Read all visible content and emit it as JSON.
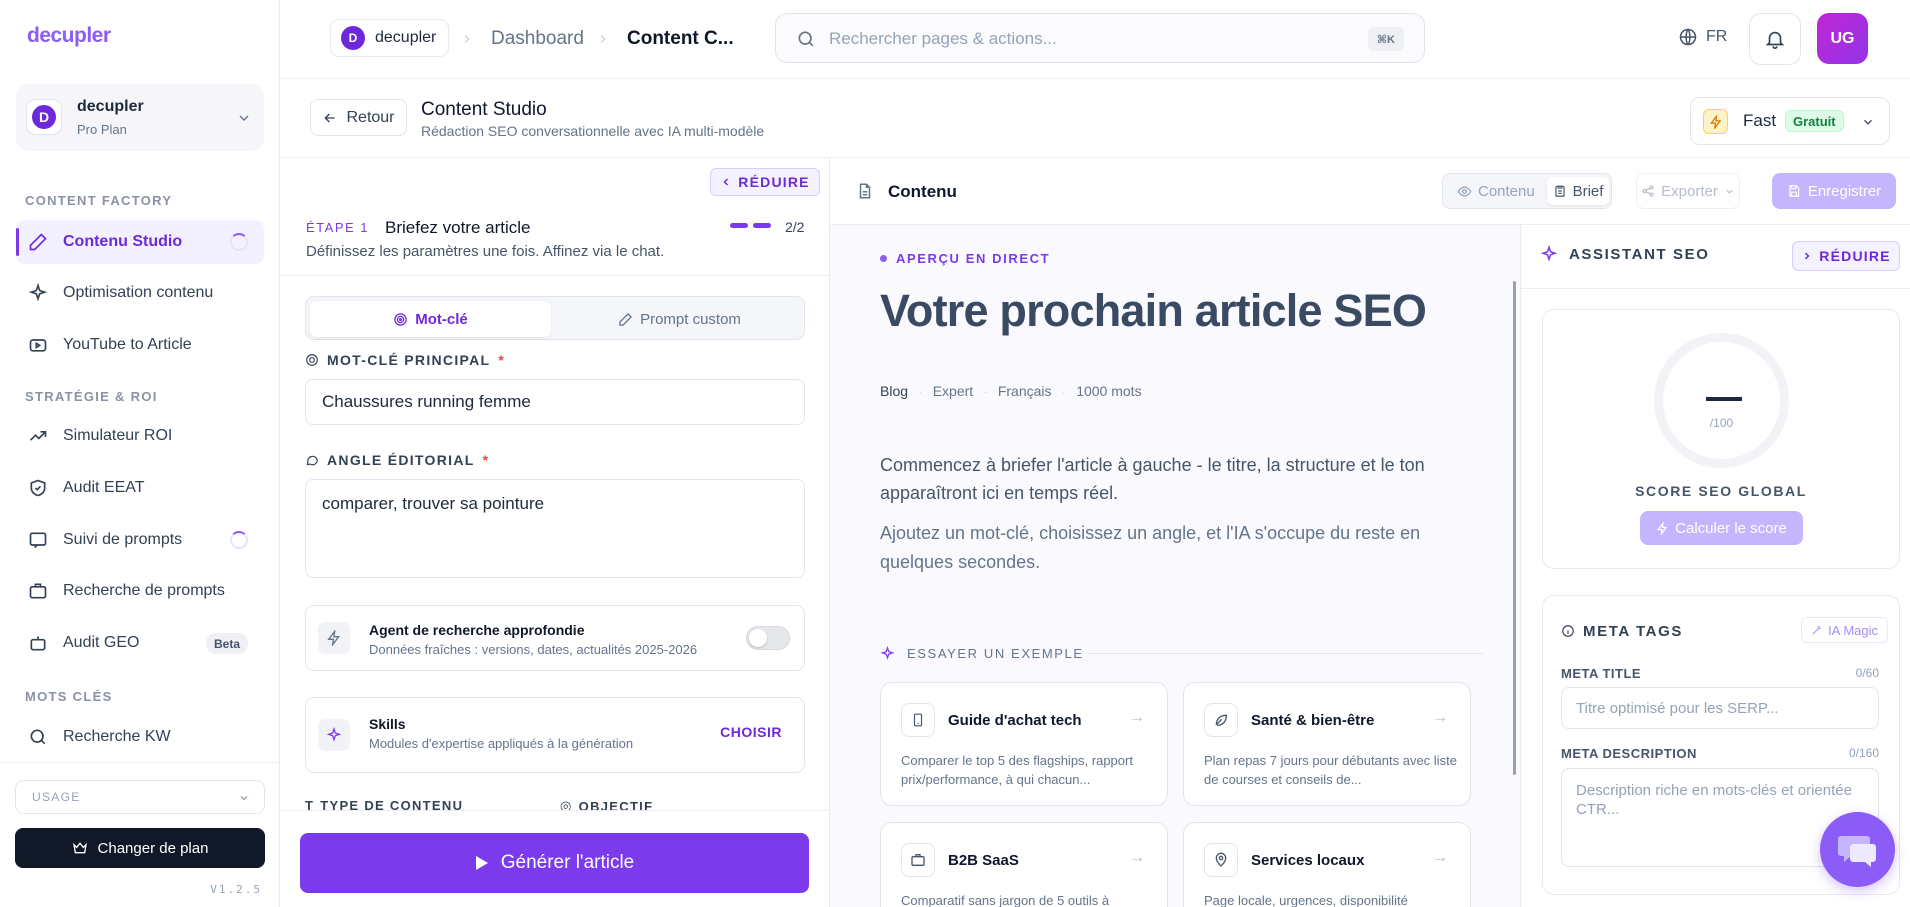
{
  "sidebar": {
    "logo": "decupler",
    "workspace": {
      "initial": "D",
      "name": "decupler",
      "plan": "Pro Plan"
    },
    "sections": [
      {
        "title": "CONTENT FACTORY",
        "items": [
          {
            "label": "Contenu Studio",
            "icon": "pencil-icon",
            "active": true,
            "loading": true
          },
          {
            "label": "Optimisation contenu",
            "icon": "sparkles-icon"
          },
          {
            "label": "YouTube to Article",
            "icon": "youtube-icon"
          }
        ]
      },
      {
        "title": "STRATÉGIE & ROI",
        "items": [
          {
            "label": "Simulateur ROI",
            "icon": "trending-up-icon"
          },
          {
            "label": "Audit EEAT",
            "icon": "shield-icon"
          },
          {
            "label": "Suivi de prompts",
            "icon": "message-icon",
            "loading": true
          },
          {
            "label": "Recherche de prompts",
            "icon": "briefcase-icon"
          },
          {
            "label": "Audit GEO",
            "icon": "bot-icon",
            "badge": "Beta"
          }
        ]
      },
      {
        "title": "MOTS CLÉS",
        "items": [
          {
            "label": "Recherche KW",
            "icon": "search-icon"
          }
        ]
      }
    ],
    "usage_label": "USAGE",
    "change_plan": "Changer de plan",
    "version": "V1.2.5"
  },
  "topbar": {
    "breadcrumb": {
      "workspace": "decupler",
      "workspace_initial": "D",
      "dashboard": "Dashboard",
      "current": "Content C..."
    },
    "search": {
      "placeholder": "Rechercher pages & actions...",
      "shortcut": "⌘K"
    },
    "language": "FR",
    "user_initials": "UG"
  },
  "page_header": {
    "back": "Retour",
    "title": "Content Studio",
    "subtitle": "Rédaction SEO conversationnelle avec IA multi-modèle",
    "model": {
      "name": "Fast",
      "badge": "Gratuit"
    }
  },
  "brief": {
    "collapse": "RÉDUIRE",
    "step_label": "ÉTAPE 1",
    "step_title": "Briefez votre article",
    "step_desc": "Définissez les paramètres une fois. Affinez via le chat.",
    "progress": "2/2",
    "modes": {
      "keyword": "Mot-clé",
      "prompt": "Prompt custom"
    },
    "keyword_label": "MOT-CLÉ PRINCIPAL",
    "keyword_value": "Chaussures running femme",
    "angle_label": "ANGLE ÉDITORIAL",
    "angle_value": "comparer, trouver sa pointure",
    "research": {
      "title": "Agent de recherche approfondie",
      "desc": "Données fraîches : versions, dates, actualités 2025-2026"
    },
    "skills": {
      "title": "Skills",
      "desc": "Modules d'expertise appliqués à la génération",
      "action": "CHOISIR"
    },
    "content_type_label": "TYPE DE CONTENU",
    "goal_label": "OBJECTIF",
    "generate": "Générer l'article"
  },
  "preview": {
    "title": "Contenu",
    "tabs": {
      "content": "Contenu",
      "brief": "Brief"
    },
    "export": "Exporter",
    "save": "Enregistrer",
    "live": "APERÇU EN DIRECT",
    "headline": "Votre prochain article SEO",
    "meta": [
      "Blog",
      "Expert",
      "Français",
      "1000 mots"
    ],
    "para1": "Commencez à briefer l'article à gauche - le titre, la structure et le ton apparaîtront ici en temps réel.",
    "para2": "Ajoutez un mot-clé, choisissez un angle, et l'IA s'occupe du reste en quelques secondes.",
    "examples_label": "ESSAYER UN EXEMPLE",
    "examples": [
      {
        "title": "Guide d'achat tech",
        "desc": "Comparer le top 5 des flagships, rapport prix/performance, à qui chacun...",
        "icon": "phone-icon"
      },
      {
        "title": "Santé & bien-être",
        "desc": "Plan repas 7 jours pour débutants avec liste de courses et conseils de...",
        "icon": "leaf-icon"
      },
      {
        "title": "B2B SaaS",
        "desc": "Comparatif sans jargon de 5 outils à",
        "icon": "briefcase-icon"
      },
      {
        "title": "Services locaux",
        "desc": "Page locale, urgences, disponibilité",
        "icon": "map-pin-icon"
      }
    ]
  },
  "assistant": {
    "title": "ASSISTANT SEO",
    "collapse": "RÉDUIRE",
    "score_value": "—",
    "score_max": "/100",
    "score_label": "SCORE SEO GLOBAL",
    "calc": "Calculer le score",
    "meta_tags": "META TAGS",
    "magic": "IA Magic",
    "meta_title_label": "META TITLE",
    "meta_title_count": "0/60",
    "meta_title_placeholder": "Titre optimisé pour les SERP...",
    "meta_desc_label": "META DESCRIPTION",
    "meta_desc_count": "0/160",
    "meta_desc_placeholder": "Description riche en mots-clés et orientée CTR..."
  }
}
